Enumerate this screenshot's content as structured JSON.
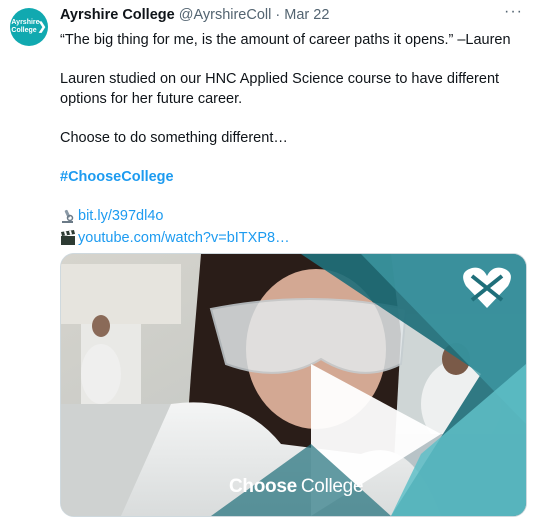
{
  "tweet": {
    "avatar_text": "Ayrshire College",
    "author_name": "Ayrshire College",
    "handle": "@AyrshireColl",
    "separator": "·",
    "date": "Mar 22",
    "more_label": "···",
    "quote": "“The big thing for me, is the amount of career paths it opens.” –Lauren",
    "paragraph": "Lauren studied on our HNC Applied Science course to have different options for her future career.",
    "cta": "Choose to do something different…",
    "hashtag": "#ChooseCollege",
    "links": [
      {
        "icon": "microscope-icon",
        "text": "bit.ly/397dl4o"
      },
      {
        "icon": "clapper-board-icon",
        "text": "youtube.com/watch?v=bITXP8…"
      }
    ]
  },
  "media": {
    "brand_choose": "Choose",
    "brand_college": "College",
    "colors": {
      "accent": "#11a9b0",
      "teal_dark": "#1f6f7a",
      "teal_light": "#5fc0c8"
    }
  }
}
